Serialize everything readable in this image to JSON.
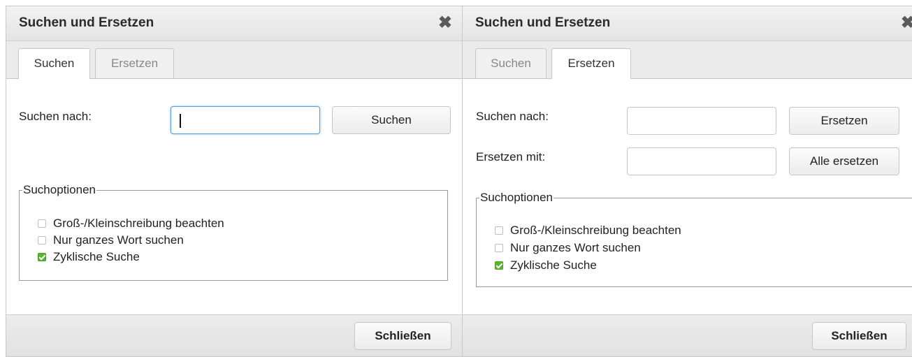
{
  "search_dialog": {
    "title": "Suchen und Ersetzen",
    "close_icon": "close-x",
    "tabs": [
      {
        "label": "Suchen",
        "active": true
      },
      {
        "label": "Ersetzen",
        "active": false
      }
    ],
    "search_label": "Suchen nach:",
    "search_value": "",
    "search_button": "Suchen",
    "options_legend": "Suchoptionen",
    "options": [
      {
        "label": "Groß-/Kleinschreibung beachten",
        "checked": false
      },
      {
        "label": "Nur ganzes Wort suchen",
        "checked": false
      },
      {
        "label": "Zyklische Suche",
        "checked": true
      }
    ],
    "close_button": "Schließen"
  },
  "replace_dialog": {
    "title": "Suchen und Ersetzen",
    "close_icon": "close-x",
    "tabs": [
      {
        "label": "Suchen",
        "active": false
      },
      {
        "label": "Ersetzen",
        "active": true
      }
    ],
    "search_label": "Suchen nach:",
    "search_value": "",
    "replace_label": "Ersetzen mit:",
    "replace_value": "",
    "replace_button": "Ersetzen",
    "replace_all_button": "Alle ersetzen",
    "options_legend": "Suchoptionen",
    "options": [
      {
        "label": "Groß-/Kleinschreibung beachten",
        "checked": false
      },
      {
        "label": "Nur ganzes Wort suchen",
        "checked": false
      },
      {
        "label": "Zyklische Suche",
        "checked": true
      }
    ],
    "close_button": "Schließen"
  },
  "colors": {
    "checkbox_checked": "#5cb531",
    "focus_border": "#5b9dd9"
  }
}
